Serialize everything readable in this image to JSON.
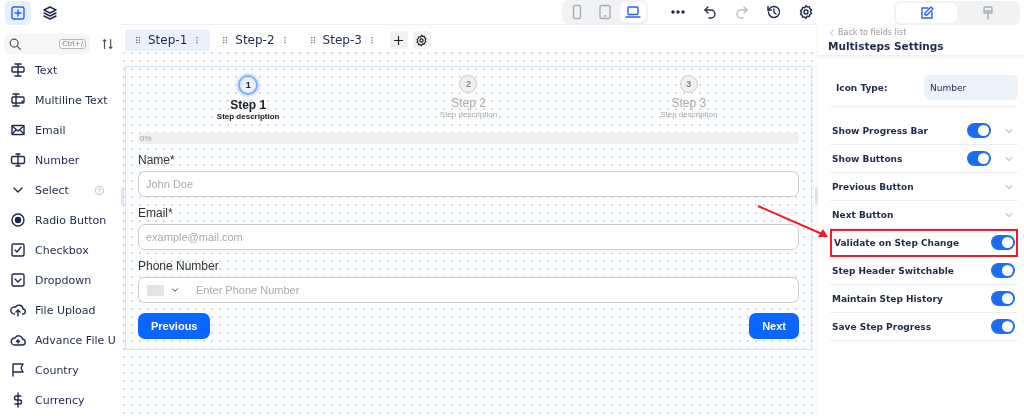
{
  "toolbar": {
    "left_tabs": [
      {
        "kind": "add",
        "selected": true
      },
      {
        "kind": "layers",
        "selected": false
      }
    ],
    "devices": [
      {
        "kind": "mobile",
        "selected": false
      },
      {
        "kind": "tablet",
        "selected": false
      },
      {
        "kind": "desktop",
        "selected": true
      }
    ],
    "panel_tabs": [
      {
        "kind": "edit",
        "selected": true
      },
      {
        "kind": "style",
        "selected": false
      }
    ]
  },
  "sidebar": {
    "search": {
      "shortcut": "Ctrl+/"
    },
    "items": [
      {
        "kind": "text",
        "label": "Text"
      },
      {
        "kind": "multiline",
        "label": "Multiline Text"
      },
      {
        "kind": "email",
        "label": "Email"
      },
      {
        "kind": "number",
        "label": "Number"
      },
      {
        "kind": "select",
        "label": "Select"
      },
      {
        "kind": "radio",
        "label": "Radio Button"
      },
      {
        "kind": "checkbox",
        "label": "Checkbox"
      },
      {
        "kind": "dropdown",
        "label": "Dropdown"
      },
      {
        "kind": "upload",
        "label": "File Upload"
      },
      {
        "kind": "advupload",
        "label": "Advance File U"
      },
      {
        "kind": "country",
        "label": "Country"
      },
      {
        "kind": "currency",
        "label": "Currency"
      }
    ]
  },
  "canvas": {
    "tabs": [
      {
        "label": "Step-1",
        "selected": true
      },
      {
        "label": "Step-2",
        "selected": false
      },
      {
        "label": "Step-3",
        "selected": false
      }
    ],
    "steps": [
      {
        "number": "1",
        "title": "Step 1",
        "description": "Step description",
        "active": true
      },
      {
        "number": "2",
        "title": "Step 2",
        "description": "Step description",
        "active": false
      },
      {
        "number": "3",
        "title": "Step 3",
        "description": "Step description",
        "active": false
      }
    ],
    "progress": {
      "label": "0%",
      "level": 0
    },
    "fields": [
      {
        "kind": "text",
        "label": "Name*",
        "placeholder": "John Doe"
      },
      {
        "kind": "text",
        "label": "Email*",
        "placeholder": "example@mail.com"
      },
      {
        "kind": "phone",
        "label": "Phone Number",
        "placeholder": "Enter Phone Number"
      }
    ],
    "buttons": [
      "Previous",
      "Next"
    ]
  },
  "settings": {
    "back": "Back to fields list",
    "title": "Multisteps Settings",
    "icon_type": {
      "label": "Icon Type:",
      "value": "Number"
    },
    "rows": [
      {
        "kind": "toggle_expand",
        "label": "Show Progress Bar",
        "on": true,
        "highlighted": false
      },
      {
        "kind": "toggle_expand",
        "label": "Show Buttons",
        "on": true,
        "highlighted": false
      },
      {
        "kind": "expand",
        "label": "Previous Button",
        "highlighted": false
      },
      {
        "kind": "expand",
        "label": "Next Button",
        "highlighted": false
      },
      {
        "kind": "toggle",
        "label": "Validate on Step Change",
        "on": true,
        "highlighted": true
      },
      {
        "kind": "toggle",
        "label": "Step Header Switchable",
        "on": true,
        "highlighted": false
      },
      {
        "kind": "toggle",
        "label": "Maintain Step History",
        "on": true,
        "highlighted": false
      },
      {
        "kind": "toggle",
        "label": "Save Step Progress",
        "on": true,
        "highlighted": false
      }
    ]
  }
}
